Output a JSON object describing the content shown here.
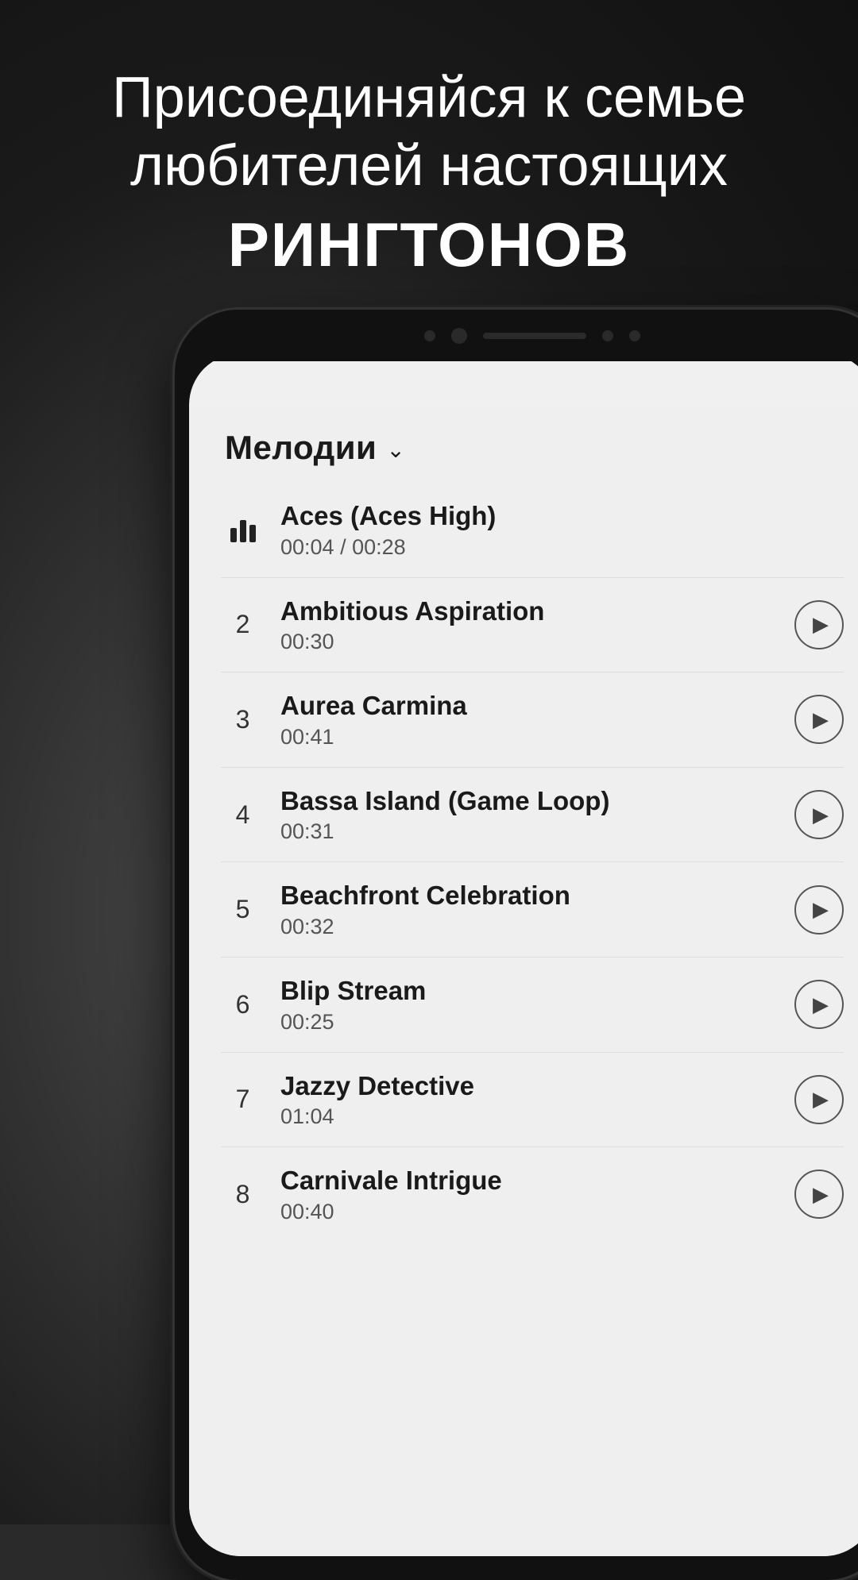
{
  "header": {
    "line1": "Присоединяйся к семье",
    "line2": "любителей настоящих",
    "line3": "РИНГТОНОВ"
  },
  "app": {
    "section_title": "Мелодии",
    "chevron": "✓",
    "tracks": [
      {
        "number": "bars",
        "name": "Aces (Aces High)",
        "duration": "00:04 / 00:28",
        "playing": true
      },
      {
        "number": "2",
        "name": "Ambitious Aspiration",
        "duration": "00:30",
        "playing": false
      },
      {
        "number": "3",
        "name": "Aurea Carmina",
        "duration": "00:41",
        "playing": false
      },
      {
        "number": "4",
        "name": "Bassa Island (Game Loop)",
        "duration": "00:31",
        "playing": false
      },
      {
        "number": "5",
        "name": "Beachfront Celebration",
        "duration": "00:32",
        "playing": false
      },
      {
        "number": "6",
        "name": "Blip Stream",
        "duration": "00:25",
        "playing": false
      },
      {
        "number": "7",
        "name": "Jazzy Detective",
        "duration": "01:04",
        "playing": false
      },
      {
        "number": "8",
        "name": "Carnivale Intrigue",
        "duration": "00:40",
        "playing": false
      }
    ]
  }
}
